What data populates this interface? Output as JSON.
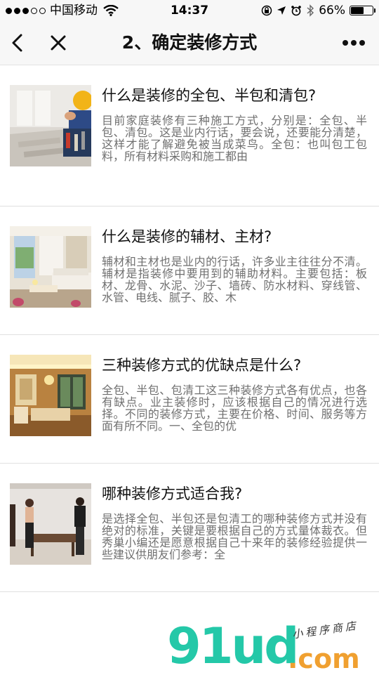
{
  "status_bar": {
    "carrier": "中国移动",
    "time": "14:37",
    "battery": "66%",
    "battery_level": 0.66
  },
  "nav": {
    "title": "2、确定装修方式",
    "back_icon": "chevron-left-icon",
    "close_icon": "close-icon",
    "more_icon": "more-icon"
  },
  "items": [
    {
      "title": "什么是装修的全包、半包和清包?",
      "desc": "目前家庭装修有三种施工方式，分别是：全包、半包、清包。这是业内行话，要会说，还要能分清楚，这样才能了解避免被当成菜鸟。全包：也叫包工包料，所有材料采购和施工都由"
    },
    {
      "title": "什么是装修的辅材、主材?",
      "desc": "辅材和主材也是业内的行话，许多业主往往分不清。辅材是指装修中要用到的辅助材料。主要包括：板材、龙骨、水泥、沙子、墙砖、防水材料、穿线管、水管、电线、腻子、胶、木"
    },
    {
      "title": "三种装修方式的优缺点是什么?",
      "desc": "全包、半包、包清工这三种装修方式各有优点，也各有缺点。业主装修时，应该根据自己的情况进行选择。不同的装修方式，主要在价格、时间、服务等方面有所不同。一、全包的优"
    },
    {
      "title": "哪种装修方式适合我?",
      "desc": "是选择全包、半包还是包清工的哪种装修方式并没有绝对的标准，关键是要根据自己的方式量体裁衣。但秀巢小编还是愿意根据自己十来年的装修经验提供一些建议供朋友们参考：全"
    }
  ],
  "watermark": {
    "main": "91ud",
    "com": ".com",
    "sub": "小程序商店"
  }
}
